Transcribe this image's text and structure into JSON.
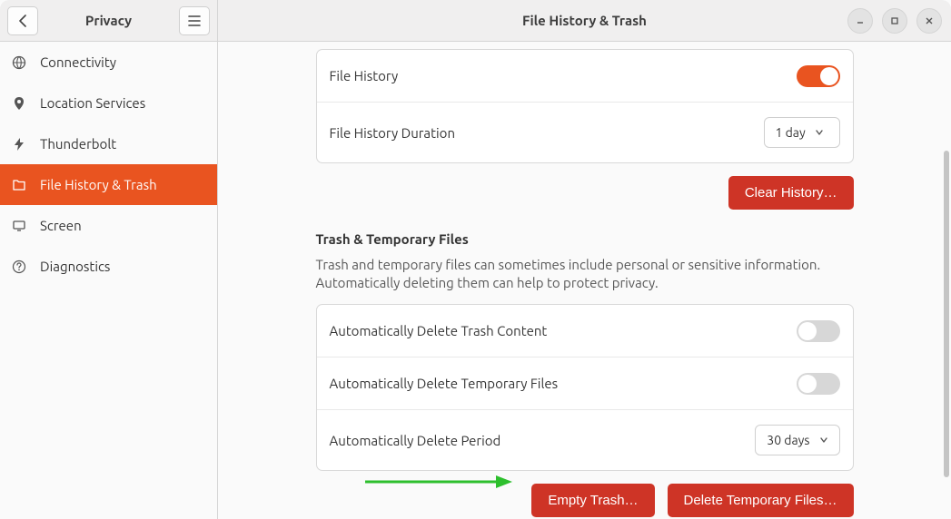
{
  "titlebar": {
    "sidebar_title": "Privacy",
    "page_title": "File History & Trash"
  },
  "sidebar": {
    "items": [
      {
        "label": "Connectivity",
        "icon": "globe-icon",
        "active": false
      },
      {
        "label": "Location Services",
        "icon": "location-icon",
        "active": false
      },
      {
        "label": "Thunderbolt",
        "icon": "thunderbolt-icon",
        "active": false
      },
      {
        "label": "File History & Trash",
        "icon": "folder-icon",
        "active": true
      },
      {
        "label": "Screen",
        "icon": "monitor-icon",
        "active": false
      },
      {
        "label": "Diagnostics",
        "icon": "question-icon",
        "active": false
      }
    ]
  },
  "main": {
    "file_history": {
      "toggle_label": "File History",
      "toggle_on": true,
      "duration_label": "File History Duration",
      "duration_value": "1 day",
      "clear_btn": "Clear History…"
    },
    "trash_section": {
      "title": "Trash & Temporary Files",
      "desc": "Trash and temporary files can sometimes include personal or sensitive information. Automatically deleting them can help to protect privacy.",
      "auto_trash_label": "Automatically Delete Trash Content",
      "auto_trash_on": false,
      "auto_temp_label": "Automatically Delete Temporary Files",
      "auto_temp_on": false,
      "period_label": "Automatically Delete Period",
      "period_value": "30 days",
      "empty_trash_btn": "Empty Trash…",
      "delete_temp_btn": "Delete Temporary Files…"
    }
  }
}
